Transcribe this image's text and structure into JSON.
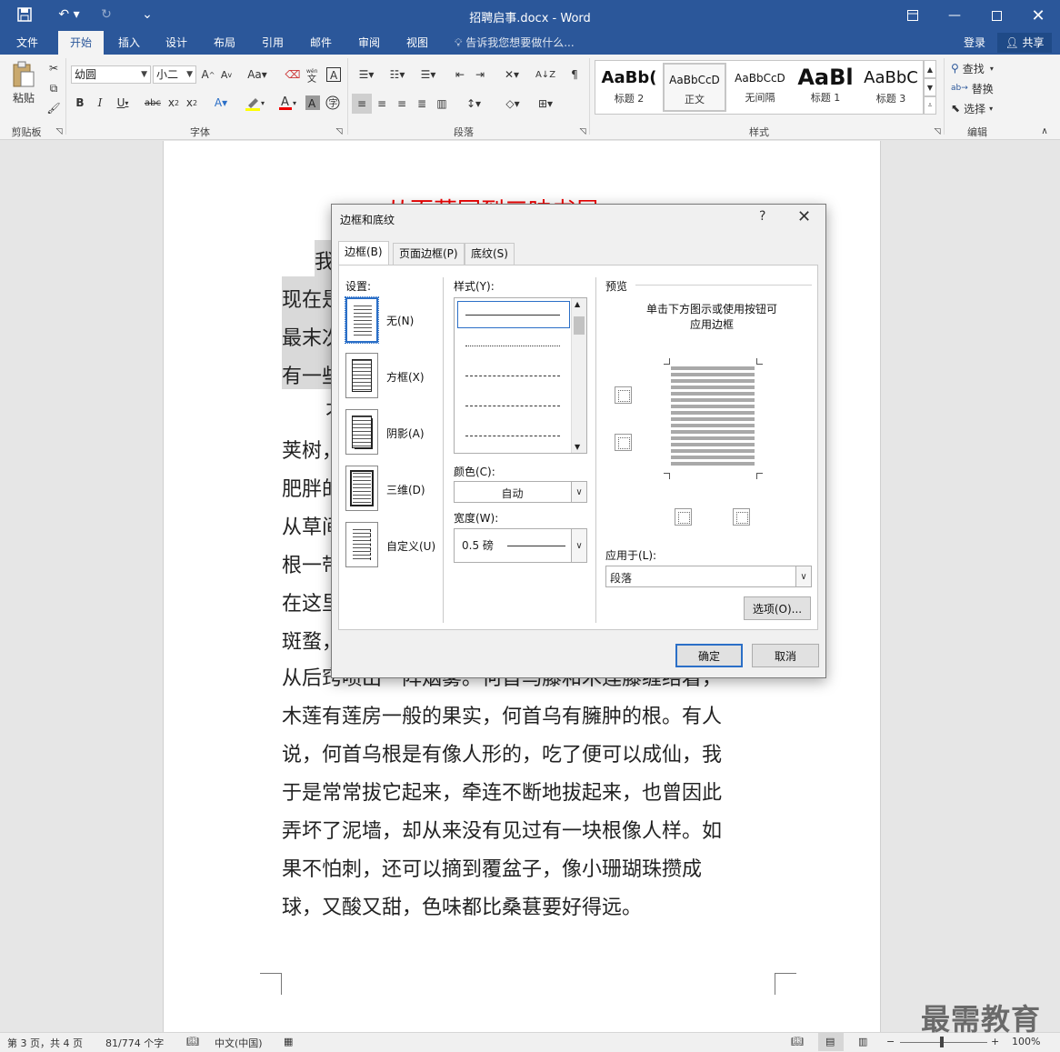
{
  "window": {
    "title": "招聘启事.docx - Word"
  },
  "quick_access": {
    "save_icon": "save-icon",
    "undo_icon": "undo-icon",
    "redo_icon": "redo-icon",
    "customize_icon": "customize-icon"
  },
  "tabs": [
    {
      "label": "文件"
    },
    {
      "label": "开始"
    },
    {
      "label": "插入"
    },
    {
      "label": "设计"
    },
    {
      "label": "布局"
    },
    {
      "label": "引用"
    },
    {
      "label": "邮件"
    },
    {
      "label": "审阅"
    },
    {
      "label": "视图"
    }
  ],
  "tell_me": "告诉我您想要做什么...",
  "account": {
    "login": "登录",
    "share": "共享"
  },
  "ribbon": {
    "clipboard": {
      "paste": "粘贴",
      "label": "剪贴板"
    },
    "font": {
      "name": "幼圆",
      "size": "小二",
      "label": "字体",
      "aa_label": "Aa"
    },
    "paragraph": {
      "label": "段落"
    },
    "styles": {
      "label": "样式",
      "items": [
        {
          "sample": "AaBb(",
          "name": "标题 2"
        },
        {
          "sample": "AaBbCcD",
          "name": "正文"
        },
        {
          "sample": "AaBbCcD",
          "name": "无间隔"
        },
        {
          "sample": "AaBl",
          "name": "标题 1"
        },
        {
          "sample": "AaBbC",
          "name": "标题 3"
        }
      ]
    },
    "editing": {
      "find": "查找",
      "replace": "替换",
      "select": "选择",
      "label": "编辑"
    }
  },
  "document": {
    "title": "从百草园到三味书屋",
    "lines": [
      "我",
      "现在是",
      "最末次",
      "有一些",
      "不",
      "荚树，",
      "肥胖的",
      "从草间",
      "根一带",
      "在这里",
      "斑蝥，",
      "从后窍喷出一阵烟雾。何首乌藤和木莲藤缠络着，",
      "木莲有莲房一般的果实，何首乌有臃肿的根。有人",
      "说，何首乌根是有像人形的，吃了便可以成仙，我",
      "于是常常拔它起来，牵连不断地拔起来，也曾因此",
      "弄坏了泥墙，却从来没有见过有一块根像人样。如",
      "果不怕刺，还可以摘到覆盆子，像小珊瑚珠攒成",
      "球，又酸又甜，色味都比桑葚要好得远。"
    ]
  },
  "status": {
    "page": "第 3 页，共 4 页",
    "words": "81/774 个字",
    "language": "中文(中国)",
    "zoom": "100%"
  },
  "watermark": "最需教育",
  "dialog": {
    "title": "边框和底纹",
    "help": "?",
    "tabs": [
      {
        "label": "边框(B)"
      },
      {
        "label": "页面边框(P)"
      },
      {
        "label": "底纹(S)"
      }
    ],
    "settings_label": "设置:",
    "settings": [
      {
        "label": "无(N)"
      },
      {
        "label": "方框(X)"
      },
      {
        "label": "阴影(A)"
      },
      {
        "label": "三维(D)"
      },
      {
        "label": "自定义(U)"
      }
    ],
    "style_label": "样式(Y):",
    "color_label": "颜色(C):",
    "color_value": "自动",
    "width_label": "宽度(W):",
    "width_value": "0.5 磅",
    "preview_label": "预览",
    "preview_hint_1": "单击下方图示或使用按钮可",
    "preview_hint_2": "应用边框",
    "apply_label": "应用于(L):",
    "apply_value": "段落",
    "options_button": "选项(O)...",
    "ok_button": "确定",
    "cancel_button": "取消"
  }
}
